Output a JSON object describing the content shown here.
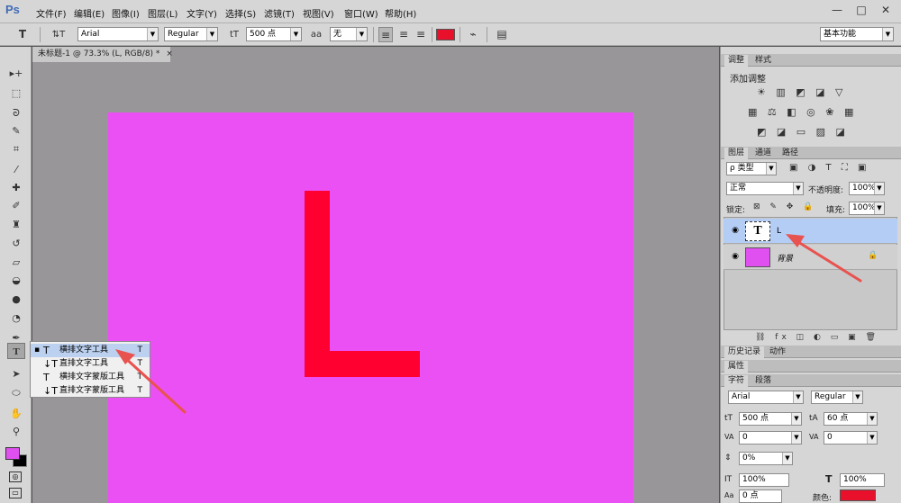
{
  "app": {
    "logo": "Ps"
  },
  "menu": [
    "文件(F)",
    "编辑(E)",
    "图像(I)",
    "图层(L)",
    "文字(Y)",
    "选择(S)",
    "滤镜(T)",
    "视图(V)",
    "窗口(W)",
    "帮助(H)"
  ],
  "window_buttons": [
    "—",
    "□",
    "✕"
  ],
  "options": {
    "tool_glyph": "T",
    "orient_glyph": "⇅T",
    "font_family": "Arial",
    "font_style": "Regular",
    "size_glyph": "tT",
    "font_size": "500 点",
    "aa_glyph": "aa",
    "antialias": "无",
    "align_left": "≡",
    "align_center": "≡",
    "align_right": "≡",
    "color": "#e8102a",
    "warp_glyph": "⌁",
    "panel_glyph": "▤",
    "workspace": "基本功能"
  },
  "document": {
    "tab_title": "未标题-1 @ 73.3% (L, RGB/8) *",
    "tab_close": "×",
    "canvas_color": "#eb50f4",
    "letter": "L",
    "letter_color": "#ff0030"
  },
  "tools": [
    {
      "name": "move-tool",
      "glyph": "▸+"
    },
    {
      "name": "marquee-tool",
      "glyph": "⬚"
    },
    {
      "name": "lasso-tool",
      "glyph": "ᘐ"
    },
    {
      "name": "quick-select-tool",
      "glyph": "✎"
    },
    {
      "name": "crop-tool",
      "glyph": "⌗"
    },
    {
      "name": "eyedropper-tool",
      "glyph": "⁄"
    },
    {
      "name": "healing-tool",
      "glyph": "✚"
    },
    {
      "name": "brush-tool",
      "glyph": "✐"
    },
    {
      "name": "stamp-tool",
      "glyph": "♜"
    },
    {
      "name": "history-brush-tool",
      "glyph": "↺"
    },
    {
      "name": "eraser-tool",
      "glyph": "▱"
    },
    {
      "name": "paint-bucket-tool",
      "glyph": "◒"
    },
    {
      "name": "blur-tool",
      "glyph": "●"
    },
    {
      "name": "dodge-tool",
      "glyph": "◔"
    },
    {
      "name": "pen-tool",
      "glyph": "✒"
    },
    {
      "name": "type-tool",
      "glyph": "T"
    },
    {
      "name": "path-select-tool",
      "glyph": "➤"
    },
    {
      "name": "shape-tool",
      "glyph": "⬭"
    },
    {
      "name": "hand-tool",
      "glyph": "✋"
    },
    {
      "name": "zoom-tool",
      "glyph": "⚲"
    }
  ],
  "colors": {
    "foreground": "#e050f0",
    "background": "#000000"
  },
  "flyout": [
    {
      "bullet": "▪",
      "icon": "T",
      "label": "横排文字工具",
      "key": "T"
    },
    {
      "bullet": "",
      "icon": "↓T",
      "label": "直排文字工具",
      "key": "T"
    },
    {
      "bullet": "",
      "icon": "T",
      "label": "横排文字蒙版工具",
      "key": "T"
    },
    {
      "bullet": "",
      "icon": "↓T",
      "label": "直排文字蒙版工具",
      "key": "T"
    }
  ],
  "adjust_panel": {
    "tabs": [
      "调整",
      "样式"
    ],
    "title": "添加调整",
    "row1": "☀ ▥ ◩ ◪ ▽",
    "row2": "▦ ⚖ ◧ ◎ ❀ ▦",
    "row3": "◩ ◪ ▭ ▨ ◪"
  },
  "layers_panel": {
    "tabs": [
      "图层",
      "通道",
      "路径"
    ],
    "filter_kind": "ρ 类型",
    "filter_icons": "▣ ◑ T ⛶ ▣",
    "blend_mode": "正常",
    "opacity_label": "不透明度:",
    "opacity": "100%",
    "lock_label": "锁定:",
    "lock_icons": "⊠ ✎ ✥ 🔒",
    "fill_label": "填充:",
    "fill": "100%",
    "layers": [
      {
        "name": "L",
        "type_glyph": "T",
        "eye": "◉",
        "selected": true
      },
      {
        "name": "背景",
        "eye": "◉",
        "lock": "🔒",
        "thumb_color": "#e050f0",
        "selected": false
      }
    ],
    "bottom_icons": "⛓ fx ◫ ◐ ▭ ▣ 🗑"
  },
  "history_panel": {
    "tabs": [
      "历史记录",
      "动作"
    ]
  },
  "properties_panel": {
    "title": "属性"
  },
  "char_panel": {
    "tabs": [
      "字符",
      "段落"
    ],
    "font_family": "Arial",
    "font_style": "Regular",
    "size_glyph": "tT",
    "size": "500 点",
    "leading_glyph": "tA",
    "leading": "60 点",
    "kerning_glyph": "VA",
    "kerning": "0",
    "tracking_glyph": "VA",
    "tracking": "0",
    "scale_glyph": "⇕",
    "baseline_pct": "0%",
    "vscale_glyph": "IT",
    "vscale": "100%",
    "hscale_glyph": "T",
    "hscale": "100%",
    "shift_glyph": "Aa",
    "shift": "0 点",
    "color_label": "颜色:",
    "color": "#e8102a"
  }
}
